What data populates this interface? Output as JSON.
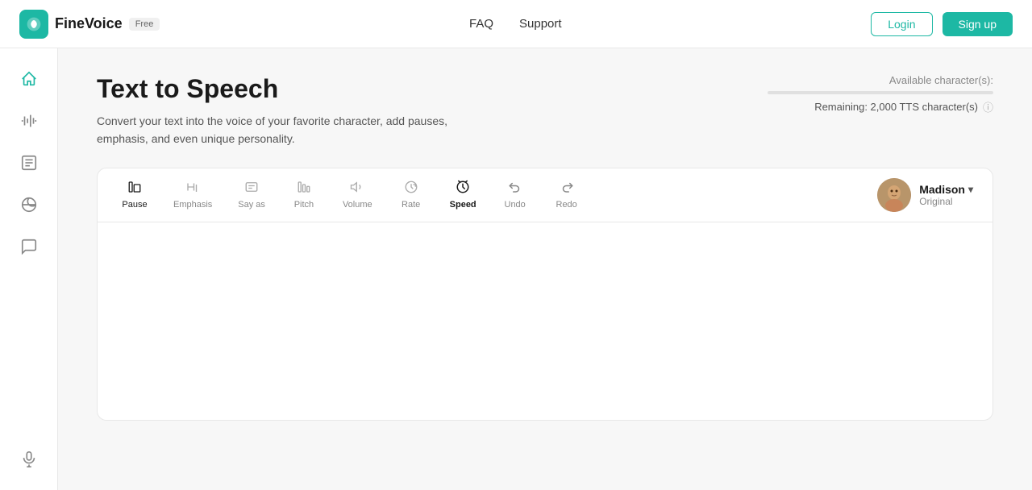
{
  "header": {
    "logo_text": "FineVoice",
    "free_badge": "Free",
    "nav": [
      {
        "label": "FAQ"
      },
      {
        "label": "Support"
      }
    ],
    "login_label": "Login",
    "signup_label": "Sign up"
  },
  "sidebar": {
    "items": [
      {
        "id": "home",
        "icon": "🏠"
      },
      {
        "id": "waveform",
        "icon": "🎙"
      },
      {
        "id": "list",
        "icon": "📋"
      },
      {
        "id": "link",
        "icon": "🔗"
      },
      {
        "id": "chat",
        "icon": "💬"
      },
      {
        "id": "mic",
        "icon": "🎤"
      }
    ]
  },
  "main": {
    "title": "Text to Speech",
    "description": "Convert your text into the voice of your favorite character, add pauses, emphasis, and even unique personality.",
    "chars_label": "Available character(s):",
    "chars_remaining": "Remaining: 2,000 TTS character(s)",
    "toolbar": {
      "tools": [
        {
          "id": "pause",
          "label": "Pause",
          "active": true
        },
        {
          "id": "emphasis",
          "label": "Emphasis",
          "active": false
        },
        {
          "id": "say-as",
          "label": "Say as",
          "active": false
        },
        {
          "id": "pitch",
          "label": "Pitch",
          "active": false
        },
        {
          "id": "volume",
          "label": "Volume",
          "active": false
        },
        {
          "id": "rate",
          "label": "Rate",
          "active": false
        },
        {
          "id": "speed",
          "label": "Speed",
          "active": true
        },
        {
          "id": "undo",
          "label": "Undo",
          "active": false
        },
        {
          "id": "redo",
          "label": "Redo",
          "active": false
        }
      ]
    },
    "voice": {
      "name": "Madison",
      "type": "Original"
    },
    "text_placeholder": ""
  }
}
